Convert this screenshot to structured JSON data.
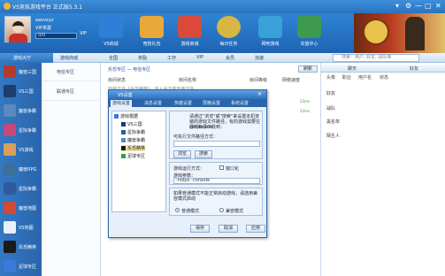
{
  "window": {
    "title": "VS竞技游戏平台 正式版5.3.1",
    "controls": [
      "▾",
      "⚙",
      "—",
      "□",
      "✕"
    ]
  },
  "user": {
    "name": "aavvxyz",
    "vip": "VIP未激",
    "level_text": "0/0",
    "vip_label": "VIP"
  },
  "header_nav": [
    {
      "label": "VS商城",
      "icon": "vs-platform-icon",
      "color": "#2e7fd8"
    },
    {
      "label": "竞技礼包",
      "icon": "gift-icon",
      "color": "#e8a93a"
    },
    {
      "label": "游戏商城",
      "icon": "store-icon",
      "color": "#d94a3a"
    },
    {
      "label": "每日任务",
      "icon": "task-wheel-icon",
      "color": "#d7b642"
    },
    {
      "label": "网吧游戏",
      "icon": "netbar-games-icon",
      "color": "#3aa0d8"
    },
    {
      "label": "充值中心",
      "icon": "recharge-icon",
      "color": "#3d9a4e"
    }
  ],
  "toolbar": {
    "home": "游戏大厅",
    "items": [
      "游戏商城",
      "全国",
      "奖励",
      "工作",
      "VIP",
      "会员",
      "加速"
    ],
    "search_placeholder": "搜索：用户, 好友, 战队等"
  },
  "sidebar": [
    {
      "label": "魔兽三国",
      "color": "#b53a2c"
    },
    {
      "label": "VS三国",
      "color": "#1f3d6e"
    },
    {
      "label": "魔兽争霸",
      "color": "#5a8ac0"
    },
    {
      "label": "星际争霸",
      "color": "#c4487a"
    },
    {
      "label": "VS游戏",
      "color": "#d6a05a"
    },
    {
      "label": "魔兽RPG",
      "color": "#3c6f9a"
    },
    {
      "label": "星际争霸",
      "color": "#2f5aa0"
    },
    {
      "label": "魔兽地图",
      "color": "#d04a3a"
    },
    {
      "label": "VS地图",
      "color": "#e8f0fa"
    },
    {
      "label": "反恐精英",
      "color": "#1a1a1a"
    },
    {
      "label": "足球专区",
      "color": "#3a7ad8"
    }
  ],
  "gamelist": [
    "电信专区",
    "联通专区"
  ],
  "main": {
    "breadcrumb": "反恐专区 — 电信专区",
    "join": "刷新",
    "columns": [
      "房间状态",
      "房间名称",
      "房间等级",
      "网络速度"
    ],
    "dim_row": "安装文件《反恐精英》，进入后下载安装文件",
    "pings": [
      "23ms",
      "23ms"
    ]
  },
  "rpanel": {
    "tabs": [
      "聊天",
      "好友"
    ],
    "columns": [
      "头像",
      "职业",
      "用户名",
      "状态"
    ],
    "groups": [
      "好友",
      "战队",
      "黑名单",
      "陌生人"
    ]
  },
  "dialog": {
    "title": "VS设置",
    "tabs": [
      "游戏设置",
      "消息设置",
      "热键设置",
      "屏蔽设置",
      "系统设置"
    ],
    "tree_root": "游戏根据",
    "tree_items": [
      "VS三国",
      "星际争霸",
      "魔兽争霸",
      "反恐精英",
      "足球专区"
    ],
    "selected_tree": "反恐精英",
    "hint": "请通过\"浏览\"或\"搜索\"来设置本机安装的游戏文件路径，有的游戏需要在游戏目录中找到：",
    "exe": "cstrike.exe",
    "path_label": "可执行文件路径方式：",
    "path_value": "",
    "browse": "浏览",
    "search": "搜索",
    "mode_label": "游戏运行方式：",
    "windowed": "窗口化",
    "params_label": "游戏参数：",
    "params_value": "-noipx -console",
    "note": "如果普通模式不能正常启动游戏，请选用兼容模式启动",
    "normal_mode": "普通模式",
    "compat_mode": "兼容模式",
    "save": "保存",
    "cancel": "取消",
    "apply": "应用"
  }
}
